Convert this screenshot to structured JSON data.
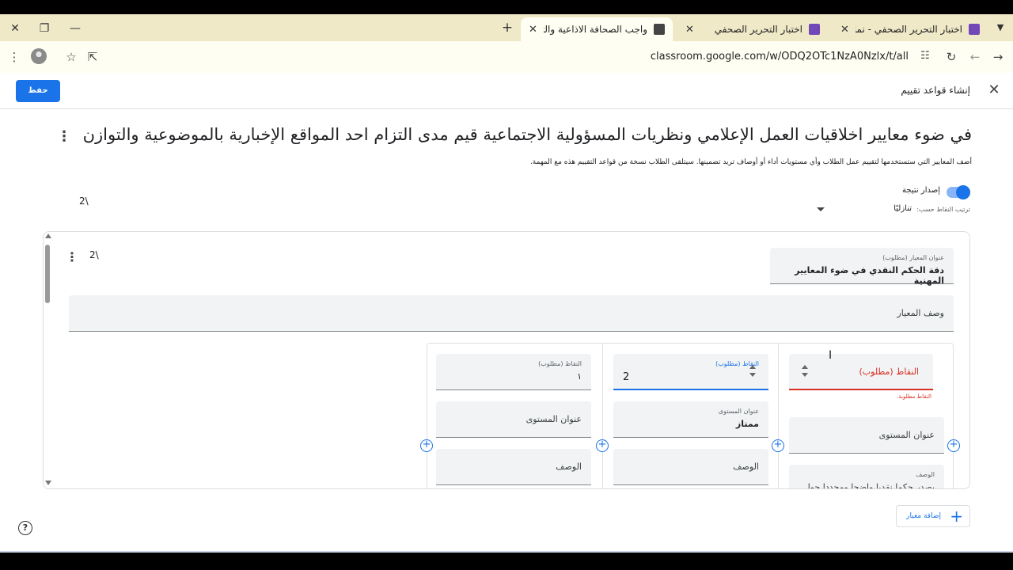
{
  "browser": {
    "tabs": [
      {
        "title": "اختبار التحرير الصحفي - نماذج Google",
        "favicon_color": "#7248b9",
        "active": false
      },
      {
        "title": "اختبار التحرير الصحفي",
        "favicon_color": "#7248b9",
        "active": false
      },
      {
        "title": "واجب الصحافة الاذاعية والتلفزيونية",
        "favicon_color": "#444444",
        "active": true
      }
    ],
    "url": "classroom.google.com/w/ODQ2OTc1NzA0Nzlx/t/all",
    "icons": [
      "close-icon",
      "restore-icon",
      "minimize-icon",
      "new-tab-icon",
      "tab-search-icon",
      "forward-icon",
      "back-icon",
      "reload-icon",
      "site-settings-icon",
      "share-icon",
      "bookmark-star-icon",
      "profile-avatar",
      "kebab-menu-icon"
    ]
  },
  "header": {
    "title": "إنشاء قواعد تقييم",
    "save_label": "حفظ"
  },
  "rubric": {
    "title": "في ضوء معايير اخلاقيات العمل الإعلامي ونظريات المسؤولية الاجتماعية قيم مدى التزام احد المواقع الإخبارية بالموضوعية والتوازن في معالجة قضية ...",
    "description": "أضف المعايير التي ستستخدمها لتقييم عمل الطلاب وأي مستويات أداء أو أوصاف تريد تضمينها. سيتلقى الطلاب نسخة من قواعد التقييم هذه مع المهمة.",
    "scoring_label": "إصدار نتيجة",
    "scoring_enabled": true,
    "sort_label": "ترتيب النقاط حسب:",
    "sort_value": "تنازليًا",
    "total_points": "2\\"
  },
  "criterion": {
    "points": "2\\",
    "title_label": "عنوان المعيار (مطلوب)",
    "title_value": "دقة الحكم النقدي في ضوء المعايير المهنية",
    "desc_placeholder": "وصف المعيار",
    "levels": [
      {
        "points_label": "النقاط (مطلوب)",
        "points_value": "",
        "error": "النقاط مطلوبة.",
        "title_label": "",
        "title_value": "عنوان المستوى",
        "desc_label": "الوصف",
        "desc_value": "يصدر حكما نقديا واضحا ومحددا حول"
      },
      {
        "points_label": "النقاط (مطلوب)",
        "points_value": "2",
        "error": "",
        "title_label": "عنوان المستوى",
        "title_value": "ممتاز",
        "desc_label": "",
        "desc_value": "الوصف"
      },
      {
        "points_label": "النقاط (مطلوب)",
        "points_value": "١",
        "error": "",
        "title_label": "",
        "title_value": "عنوان المستوى",
        "desc_label": "",
        "desc_value": "الوصف"
      }
    ]
  },
  "footer": {
    "add_criterion_label": "إضافة معيار",
    "help_symbol": "?"
  },
  "colors": {
    "accent": "#1a73e8",
    "error": "#d93025",
    "tabbar": "#efe9c8"
  }
}
